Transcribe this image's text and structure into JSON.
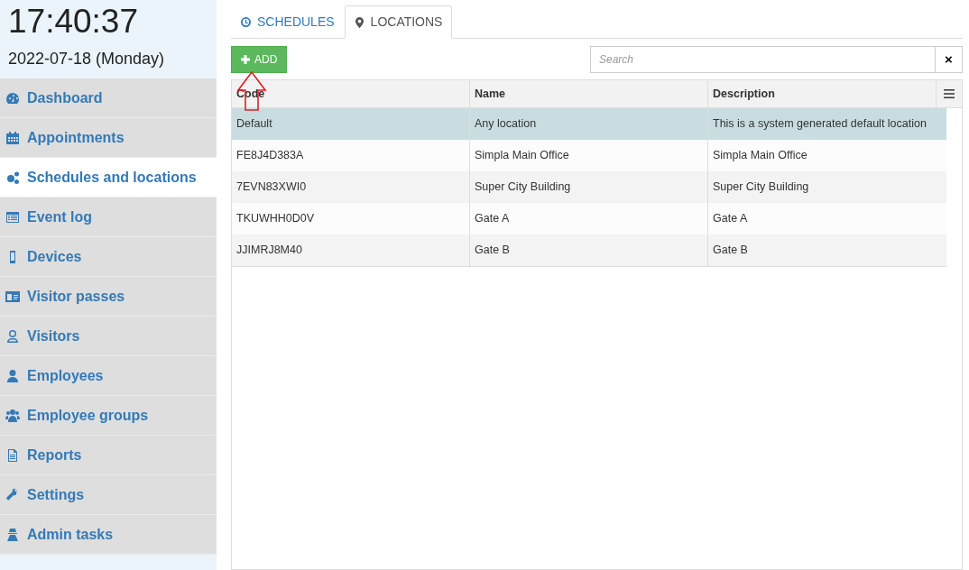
{
  "clock": {
    "time": "17:40:37",
    "date": "2022-07-18 (Monday)"
  },
  "sidebar": {
    "items": [
      {
        "label": "Dashboard",
        "selected": false
      },
      {
        "label": "Appointments",
        "selected": false
      },
      {
        "label": "Schedules and locations",
        "selected": true
      },
      {
        "label": "Event log",
        "selected": false
      },
      {
        "label": "Devices",
        "selected": false
      },
      {
        "label": "Visitor passes",
        "selected": false
      },
      {
        "label": "Visitors",
        "selected": false
      },
      {
        "label": "Employees",
        "selected": false
      },
      {
        "label": "Employee groups",
        "selected": false
      },
      {
        "label": "Reports",
        "selected": false
      },
      {
        "label": "Settings",
        "selected": false
      },
      {
        "label": "Admin tasks",
        "selected": false
      }
    ]
  },
  "tabs": [
    {
      "label": "SCHEDULES",
      "selected": false
    },
    {
      "label": "LOCATIONS",
      "selected": true
    }
  ],
  "toolbar": {
    "add_button": "ADD",
    "search": {
      "placeholder": "Search"
    },
    "clear_button": "×"
  },
  "table": {
    "columns": [
      "Code",
      "Name",
      "Description"
    ],
    "rows": [
      {
        "cells": [
          "Default",
          "Any location",
          "This is a system generated default location"
        ],
        "selected": true
      },
      {
        "cells": [
          "FE8J4D383A",
          "Simpla Main Office",
          "Simpla Main Office"
        ],
        "selected": false
      },
      {
        "cells": [
          "7EVN83XWI0",
          "Super City Building",
          "Super City Building"
        ],
        "selected": false
      },
      {
        "cells": [
          "TKUWHH0D0V",
          "Gate A",
          "Gate A"
        ],
        "selected": false
      },
      {
        "cells": [
          "JJIMRJ8M40",
          "Gate B",
          "Gate B"
        ],
        "selected": false
      }
    ]
  }
}
